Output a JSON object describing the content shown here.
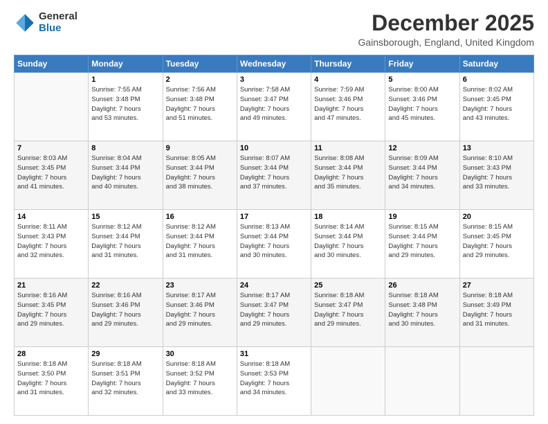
{
  "logo": {
    "line1": "General",
    "line2": "Blue"
  },
  "title": "December 2025",
  "location": "Gainsborough, England, United Kingdom",
  "days_header": [
    "Sunday",
    "Monday",
    "Tuesday",
    "Wednesday",
    "Thursday",
    "Friday",
    "Saturday"
  ],
  "weeks": [
    [
      {
        "day": "",
        "content": ""
      },
      {
        "day": "1",
        "content": "Sunrise: 7:55 AM\nSunset: 3:48 PM\nDaylight: 7 hours\nand 53 minutes."
      },
      {
        "day": "2",
        "content": "Sunrise: 7:56 AM\nSunset: 3:48 PM\nDaylight: 7 hours\nand 51 minutes."
      },
      {
        "day": "3",
        "content": "Sunrise: 7:58 AM\nSunset: 3:47 PM\nDaylight: 7 hours\nand 49 minutes."
      },
      {
        "day": "4",
        "content": "Sunrise: 7:59 AM\nSunset: 3:46 PM\nDaylight: 7 hours\nand 47 minutes."
      },
      {
        "day": "5",
        "content": "Sunrise: 8:00 AM\nSunset: 3:46 PM\nDaylight: 7 hours\nand 45 minutes."
      },
      {
        "day": "6",
        "content": "Sunrise: 8:02 AM\nSunset: 3:45 PM\nDaylight: 7 hours\nand 43 minutes."
      }
    ],
    [
      {
        "day": "7",
        "content": "Sunrise: 8:03 AM\nSunset: 3:45 PM\nDaylight: 7 hours\nand 41 minutes."
      },
      {
        "day": "8",
        "content": "Sunrise: 8:04 AM\nSunset: 3:44 PM\nDaylight: 7 hours\nand 40 minutes."
      },
      {
        "day": "9",
        "content": "Sunrise: 8:05 AM\nSunset: 3:44 PM\nDaylight: 7 hours\nand 38 minutes."
      },
      {
        "day": "10",
        "content": "Sunrise: 8:07 AM\nSunset: 3:44 PM\nDaylight: 7 hours\nand 37 minutes."
      },
      {
        "day": "11",
        "content": "Sunrise: 8:08 AM\nSunset: 3:44 PM\nDaylight: 7 hours\nand 35 minutes."
      },
      {
        "day": "12",
        "content": "Sunrise: 8:09 AM\nSunset: 3:44 PM\nDaylight: 7 hours\nand 34 minutes."
      },
      {
        "day": "13",
        "content": "Sunrise: 8:10 AM\nSunset: 3:43 PM\nDaylight: 7 hours\nand 33 minutes."
      }
    ],
    [
      {
        "day": "14",
        "content": "Sunrise: 8:11 AM\nSunset: 3:43 PM\nDaylight: 7 hours\nand 32 minutes."
      },
      {
        "day": "15",
        "content": "Sunrise: 8:12 AM\nSunset: 3:44 PM\nDaylight: 7 hours\nand 31 minutes."
      },
      {
        "day": "16",
        "content": "Sunrise: 8:12 AM\nSunset: 3:44 PM\nDaylight: 7 hours\nand 31 minutes."
      },
      {
        "day": "17",
        "content": "Sunrise: 8:13 AM\nSunset: 3:44 PM\nDaylight: 7 hours\nand 30 minutes."
      },
      {
        "day": "18",
        "content": "Sunrise: 8:14 AM\nSunset: 3:44 PM\nDaylight: 7 hours\nand 30 minutes."
      },
      {
        "day": "19",
        "content": "Sunrise: 8:15 AM\nSunset: 3:44 PM\nDaylight: 7 hours\nand 29 minutes."
      },
      {
        "day": "20",
        "content": "Sunrise: 8:15 AM\nSunset: 3:45 PM\nDaylight: 7 hours\nand 29 minutes."
      }
    ],
    [
      {
        "day": "21",
        "content": "Sunrise: 8:16 AM\nSunset: 3:45 PM\nDaylight: 7 hours\nand 29 minutes."
      },
      {
        "day": "22",
        "content": "Sunrise: 8:16 AM\nSunset: 3:46 PM\nDaylight: 7 hours\nand 29 minutes."
      },
      {
        "day": "23",
        "content": "Sunrise: 8:17 AM\nSunset: 3:46 PM\nDaylight: 7 hours\nand 29 minutes."
      },
      {
        "day": "24",
        "content": "Sunrise: 8:17 AM\nSunset: 3:47 PM\nDaylight: 7 hours\nand 29 minutes."
      },
      {
        "day": "25",
        "content": "Sunrise: 8:18 AM\nSunset: 3:47 PM\nDaylight: 7 hours\nand 29 minutes."
      },
      {
        "day": "26",
        "content": "Sunrise: 8:18 AM\nSunset: 3:48 PM\nDaylight: 7 hours\nand 30 minutes."
      },
      {
        "day": "27",
        "content": "Sunrise: 8:18 AM\nSunset: 3:49 PM\nDaylight: 7 hours\nand 31 minutes."
      }
    ],
    [
      {
        "day": "28",
        "content": "Sunrise: 8:18 AM\nSunset: 3:50 PM\nDaylight: 7 hours\nand 31 minutes."
      },
      {
        "day": "29",
        "content": "Sunrise: 8:18 AM\nSunset: 3:51 PM\nDaylight: 7 hours\nand 32 minutes."
      },
      {
        "day": "30",
        "content": "Sunrise: 8:18 AM\nSunset: 3:52 PM\nDaylight: 7 hours\nand 33 minutes."
      },
      {
        "day": "31",
        "content": "Sunrise: 8:18 AM\nSunset: 3:53 PM\nDaylight: 7 hours\nand 34 minutes."
      },
      {
        "day": "",
        "content": ""
      },
      {
        "day": "",
        "content": ""
      },
      {
        "day": "",
        "content": ""
      }
    ]
  ]
}
